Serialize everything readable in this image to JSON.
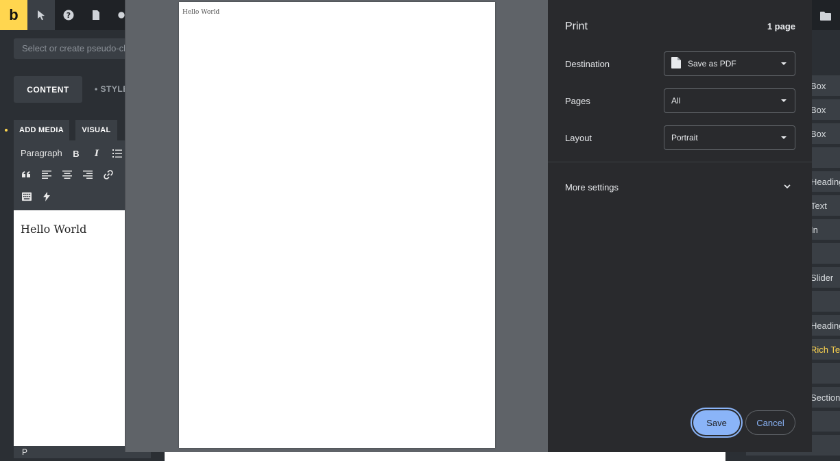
{
  "builder": {
    "logo_letter": "b",
    "pseudo_placeholder": "Select or create pseudo-class",
    "tabs": {
      "content": "CONTENT",
      "style": "• STYLE"
    },
    "editor_tabs": {
      "add_media": "ADD MEDIA",
      "visual": "VISUAL"
    },
    "format_select": "Paragraph",
    "editor_content": "Hello World",
    "status_path": "P"
  },
  "right_sidebar": {
    "items": [
      "Box",
      "Box",
      "Box",
      "",
      "Heading",
      "Text",
      "In",
      "",
      "Slider",
      "",
      "Heading",
      "Rich Text",
      "",
      "Section",
      "",
      ""
    ],
    "highlight_color": "#ffd64f"
  },
  "print_dialog": {
    "title": "Print",
    "page_count": "1 page",
    "preview_text": "Hello World",
    "destination": {
      "label": "Destination",
      "value": "Save as PDF"
    },
    "pages": {
      "label": "Pages",
      "value": "All"
    },
    "layout": {
      "label": "Layout",
      "value": "Portrait"
    },
    "more_settings": "More settings",
    "save_label": "Save",
    "cancel_label": "Cancel",
    "accent_color": "#8ab4f8"
  }
}
